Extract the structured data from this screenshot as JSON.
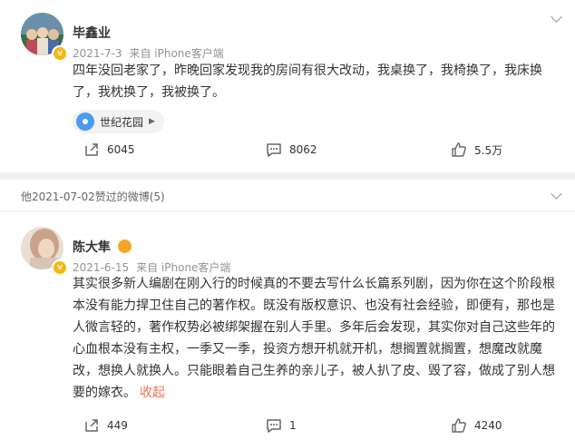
{
  "post": {
    "author": "毕鑫业",
    "date": "2021-7-3",
    "source": "来自 iPhone客户端",
    "text": "四年没回老家了，昨晚回家发现我的房间有很大改动，我桌换了，我椅换了，我床换了，我枕换了，我被换了。",
    "location": "世纪花园",
    "forwards": "6045",
    "comments": "8062",
    "likes": "5.5万"
  },
  "liked_header": "他2021-07-02赞过的微博(5)",
  "comment": {
    "author": "陈大隼",
    "date": "2021-6-15",
    "source": "来自 iPhone客户端",
    "text": "其实很多新人编剧在刚入行的时候真的不要去写什么长篇系列剧，因为你在这个阶段根本没有能力捍卫住自己的著作权。既没有版权意识、也没有社会经验，即便有，那也是人微言轻的，著作权势必被绑架握在别人手里。多年后会发现，其实你对自己这些年的心血根本没有主权，一季又一季，投资方想开机就开机，想搁置就搁置，想魔改就魔改，想换人就换人。只能眼着自己生养的亲儿子，被人扒了皮、毁了容，做成了别人想要的嫁衣。",
    "collapse_label": "收起",
    "forwards": "449",
    "comments": "1",
    "likes": "4240"
  },
  "colors": {
    "accent": "#eb7350",
    "badge": "#f5b90f",
    "location_pin": "#4a9cf0",
    "meta": "#939393"
  },
  "icons": [
    "chevron-down-icon",
    "verified-badge-icon",
    "location-pin-icon",
    "forward-icon",
    "comment-icon",
    "like-icon",
    "emoji-icon"
  ]
}
